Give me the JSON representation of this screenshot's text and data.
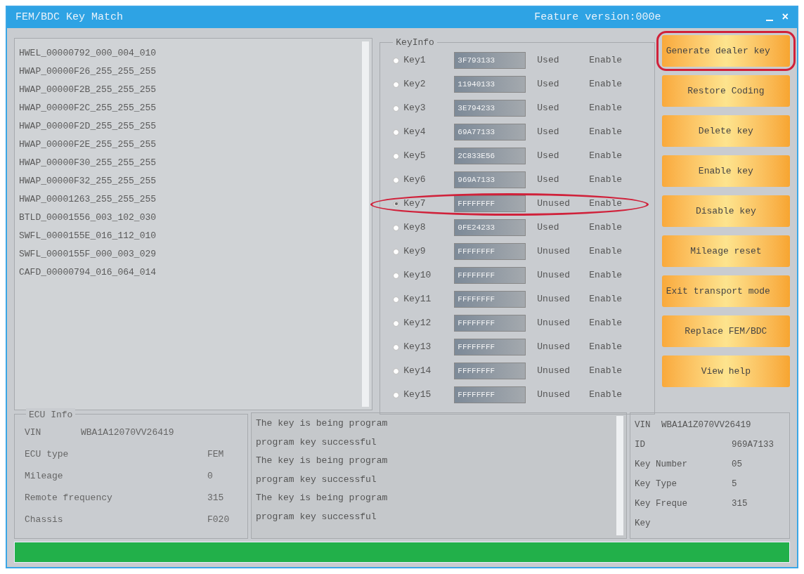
{
  "window": {
    "title": "FEM/BDC Key Match",
    "version": "Feature version:000e",
    "close": "×"
  },
  "module_list": [
    "HWEL_00000792_000_004_010",
    "HWAP_00000F26_255_255_255",
    "HWAP_00000F2B_255_255_255",
    "HWAP_00000F2C_255_255_255",
    "HWAP_00000F2D_255_255_255",
    "HWAP_00000F2E_255_255_255",
    "HWAP_00000F30_255_255_255",
    "HWAP_00000F32_255_255_255",
    "HWAP_00001263_255_255_255",
    "BTLD_00001556_003_102_030",
    "SWFL_0000155E_016_112_010",
    "SWFL_0000155F_000_003_029",
    "CAFD_00000794_016_064_014"
  ],
  "key_info": {
    "title": "KeyInfo",
    "keys": [
      {
        "label": "Key1",
        "id": "3F793133",
        "usage": "Used",
        "status": "Enable",
        "selected": false,
        "highlighted": false
      },
      {
        "label": "Key2",
        "id": "11940133",
        "usage": "Used",
        "status": "Enable",
        "selected": false,
        "highlighted": false
      },
      {
        "label": "Key3",
        "id": "3E794233",
        "usage": "Used",
        "status": "Enable",
        "selected": false,
        "highlighted": false
      },
      {
        "label": "Key4",
        "id": "69A77133",
        "usage": "Used",
        "status": "Enable",
        "selected": false,
        "highlighted": false
      },
      {
        "label": "Key5",
        "id": "2C833E56",
        "usage": "Used",
        "status": "Enable",
        "selected": false,
        "highlighted": false
      },
      {
        "label": "Key6",
        "id": "969A7133",
        "usage": "Used",
        "status": "Enable",
        "selected": false,
        "highlighted": false
      },
      {
        "label": "Key7",
        "id": "FFFFFFFF",
        "usage": "Unused",
        "status": "Enable",
        "selected": true,
        "highlighted": true
      },
      {
        "label": "Key8",
        "id": "0FE24233",
        "usage": "Used",
        "status": "Enable",
        "selected": false,
        "highlighted": false
      },
      {
        "label": "Key9",
        "id": "FFFFFFFF",
        "usage": "Unused",
        "status": "Enable",
        "selected": false,
        "highlighted": false
      },
      {
        "label": "Key10",
        "id": "FFFFFFFF",
        "usage": "Unused",
        "status": "Enable",
        "selected": false,
        "highlighted": false
      },
      {
        "label": "Key11",
        "id": "FFFFFFFF",
        "usage": "Unused",
        "status": "Enable",
        "selected": false,
        "highlighted": false
      },
      {
        "label": "Key12",
        "id": "FFFFFFFF",
        "usage": "Unused",
        "status": "Enable",
        "selected": false,
        "highlighted": false
      },
      {
        "label": "Key13",
        "id": "FFFFFFFF",
        "usage": "Unused",
        "status": "Enable",
        "selected": false,
        "highlighted": false
      },
      {
        "label": "Key14",
        "id": "FFFFFFFF",
        "usage": "Unused",
        "status": "Enable",
        "selected": false,
        "highlighted": false
      },
      {
        "label": "Key15",
        "id": "FFFFFFFF",
        "usage": "Unused",
        "status": "Enable",
        "selected": false,
        "highlighted": false
      }
    ]
  },
  "buttons": [
    {
      "label": "Generate dealer key",
      "highlighted": true
    },
    {
      "label": "Restore Coding",
      "highlighted": false
    },
    {
      "label": "Delete key",
      "highlighted": false
    },
    {
      "label": "Enable key",
      "highlighted": false
    },
    {
      "label": "Disable key",
      "highlighted": false
    },
    {
      "label": "Mileage reset",
      "highlighted": false
    },
    {
      "label": "Exit transport mode",
      "highlighted": false
    },
    {
      "label": "Replace FEM/BDC",
      "highlighted": false
    },
    {
      "label": "View help",
      "highlighted": false
    }
  ],
  "ecu_info": {
    "title": "ECU Info",
    "rows": [
      {
        "label": "VIN",
        "value": "WBA1A12070VV26419"
      },
      {
        "label": "ECU type",
        "value": "FEM"
      },
      {
        "label": "Mileage",
        "value": "0"
      },
      {
        "label": "Remote frequency",
        "value": "315"
      },
      {
        "label": "Chassis",
        "value": "F020"
      }
    ]
  },
  "log": [
    "The key is being program",
    "program key successful",
    "The key is being program",
    "program key successful",
    "The key is being program",
    "program key successful"
  ],
  "key_details": [
    {
      "label": "VIN",
      "value": "WBA1A1Z070VV26419"
    },
    {
      "label": "ID",
      "value": "969A7133"
    },
    {
      "label": "Key Number",
      "value": "05"
    },
    {
      "label": "Key Type",
      "value": "5"
    },
    {
      "label": "Key Freque",
      "value": "315"
    },
    {
      "label": "Key"
    }
  ],
  "progress": {
    "level": 1
  }
}
